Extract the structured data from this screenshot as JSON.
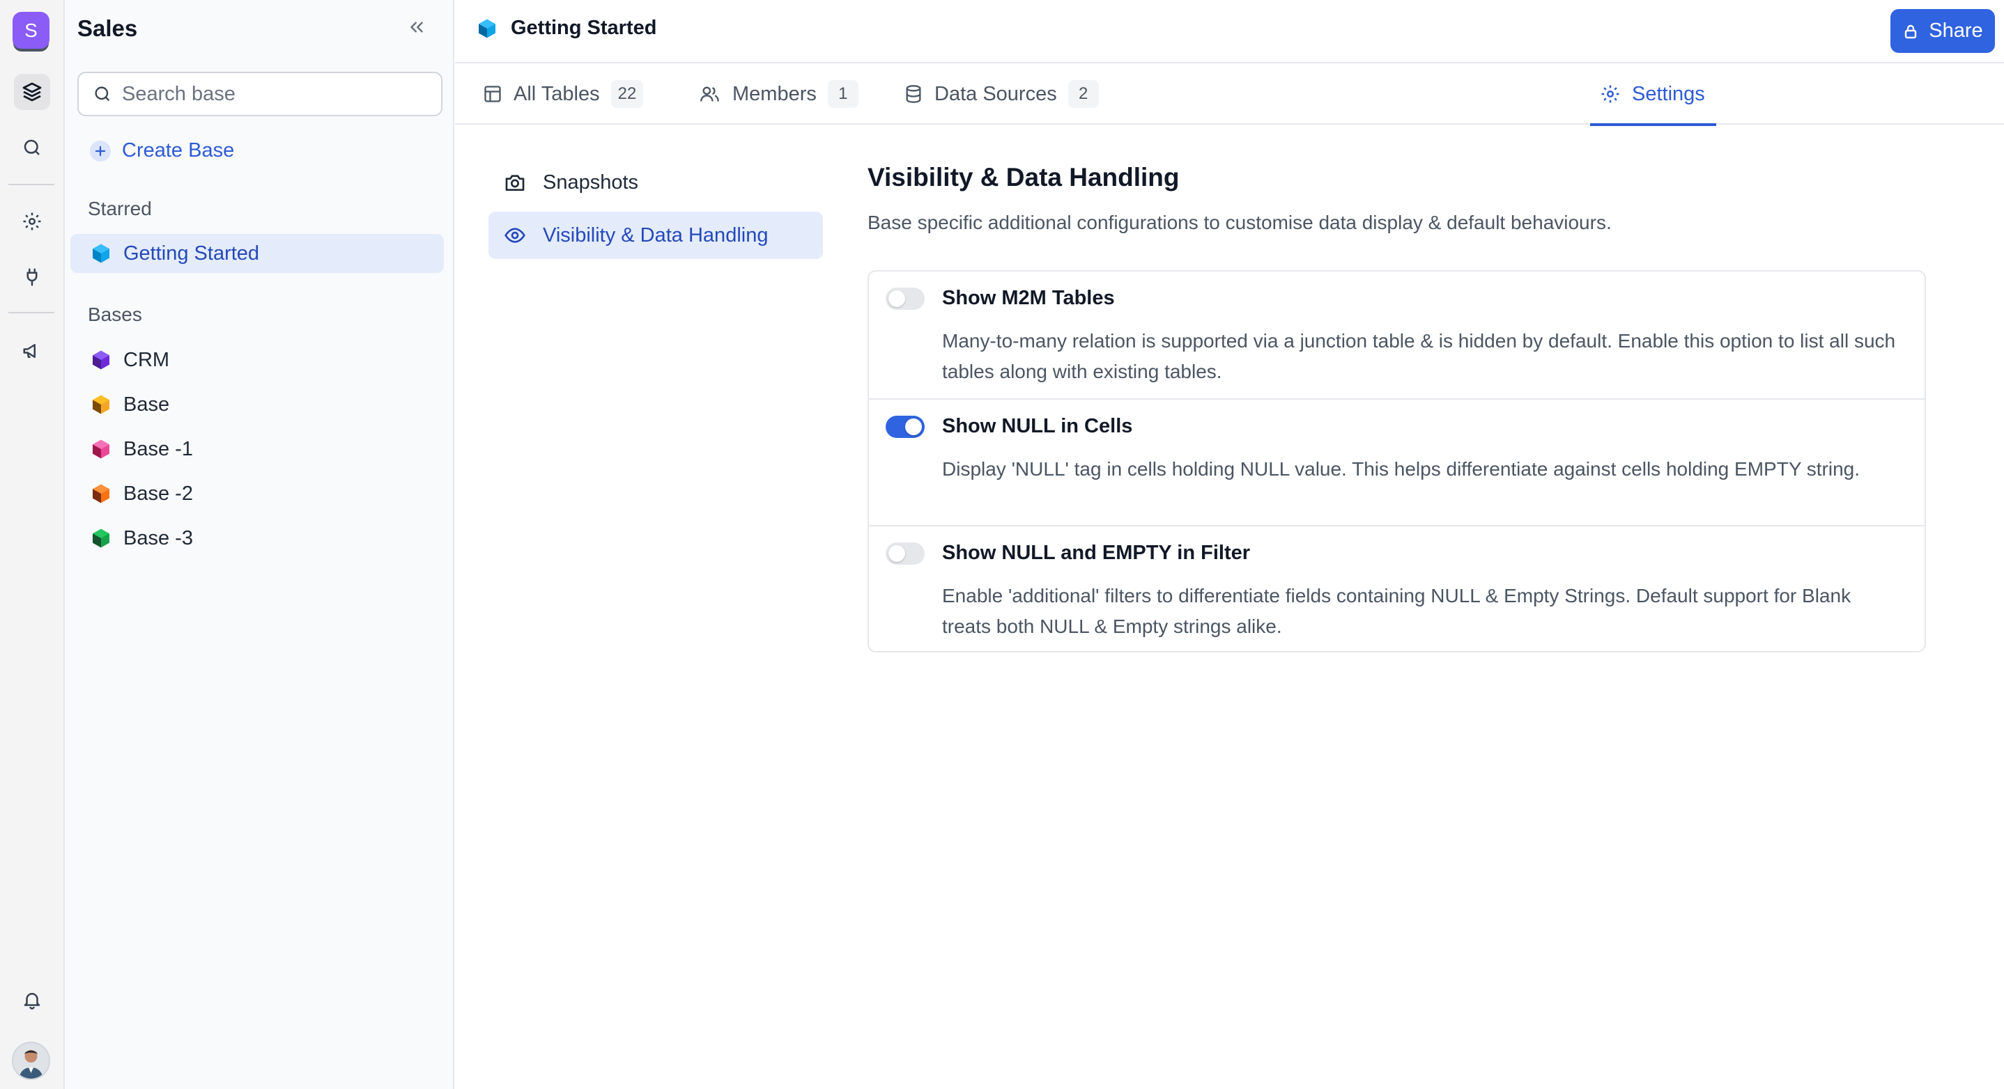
{
  "workspace": {
    "initial": "S"
  },
  "sidebar": {
    "title": "Sales",
    "search_placeholder": "Search base",
    "create_label": "Create Base",
    "starred_label": "Starred",
    "starred_items": [
      {
        "label": "Getting Started",
        "color": "#0ea5e9"
      }
    ],
    "bases_label": "Bases",
    "bases": [
      {
        "label": "CRM",
        "color": "#6d28d9"
      },
      {
        "label": "Base",
        "color": "#f5a524"
      },
      {
        "label": "Base -1",
        "color": "#ec4899"
      },
      {
        "label": "Base -2",
        "color": "#f97316"
      },
      {
        "label": "Base -3",
        "color": "#16a34a"
      }
    ]
  },
  "header": {
    "title": "Getting Started",
    "share_label": "Share"
  },
  "tabs": [
    {
      "label": "All Tables",
      "count": "22",
      "icon": "table-icon"
    },
    {
      "label": "Members",
      "count": "1",
      "icon": "users-icon"
    },
    {
      "label": "Data Sources",
      "count": "2",
      "icon": "database-icon"
    },
    {
      "label": "Settings",
      "icon": "gear-icon",
      "active": true
    }
  ],
  "settings_nav": [
    {
      "label": "Snapshots",
      "icon": "camera-icon"
    },
    {
      "label": "Visibility & Data Handling",
      "icon": "eye-icon",
      "active": true
    }
  ],
  "content": {
    "title": "Visibility & Data Handling",
    "description": "Base specific additional configurations to customise data display & default behaviours.",
    "options": [
      {
        "title": "Show M2M Tables",
        "enabled": false,
        "description": "Many-to-many relation is supported via a junction table & is hidden by default. Enable this option to list all such tables along with existing tables."
      },
      {
        "title": "Show NULL in Cells",
        "enabled": true,
        "description": "Display 'NULL' tag in cells holding NULL value. This helps differentiate against cells holding EMPTY string."
      },
      {
        "title": "Show NULL and EMPTY in Filter",
        "enabled": false,
        "description": "Enable 'additional' filters to differentiate fields containing NULL & Empty Strings. Default support for Blank treats both NULL & Empty strings alike."
      }
    ]
  },
  "colors": {
    "accent": "#2f63e0",
    "workspace": "#8b5cf6"
  }
}
